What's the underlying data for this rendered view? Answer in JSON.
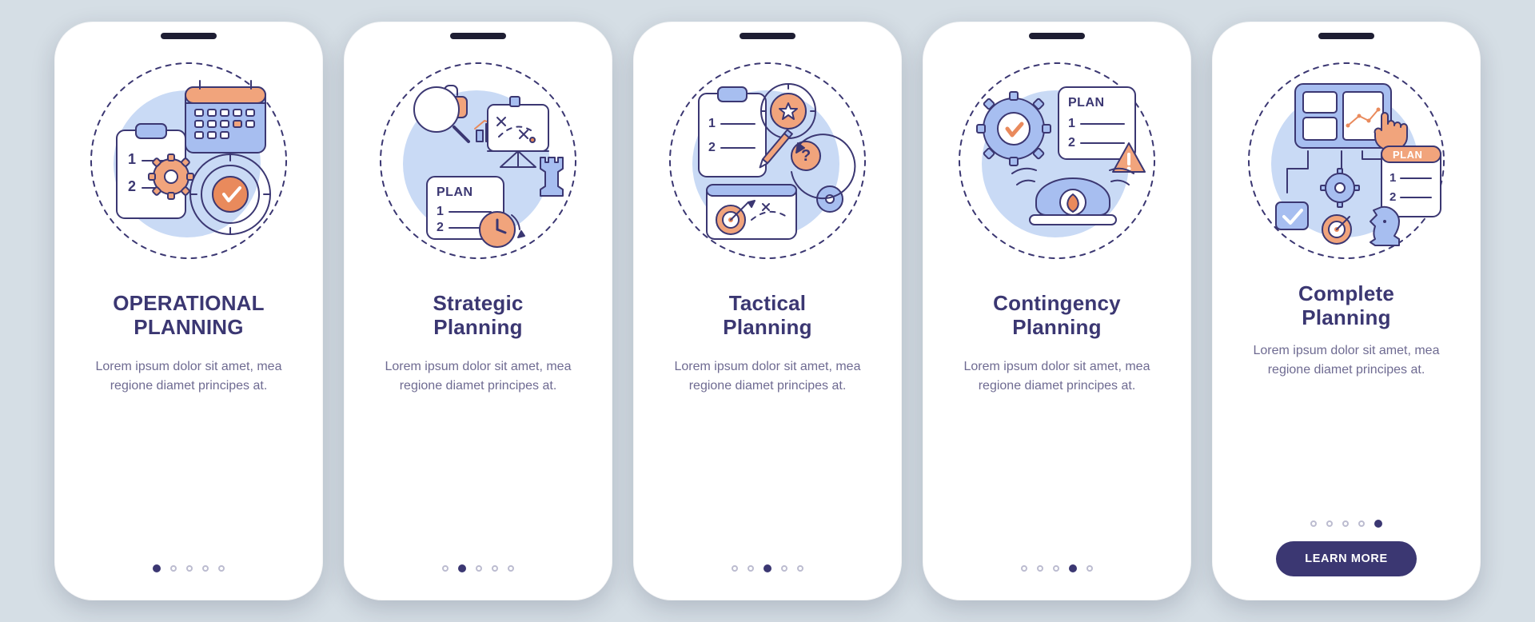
{
  "meta": {
    "dimensions": "1920x778"
  },
  "colors": {
    "background": "#d5dee5",
    "surface": "#ffffff",
    "primary": "#3b3772",
    "accent_blue": "#a7bef0",
    "accent_orange": "#f1a47c",
    "dot_inactive": "#bcbcd0"
  },
  "lorem": "Lorem ipsum dolor sit amet, mea regione diamet principes at.",
  "cta_label": "LEARN MORE",
  "svg_labels": {
    "plan": "PLAN",
    "one": "1",
    "two": "2"
  },
  "screens": [
    {
      "id": "operational",
      "title_line1": "OPERATIONAL",
      "title_line2": "PLANNING",
      "title_case": "upper",
      "icon": "operational-illustration",
      "icon_elements": [
        "calendar-icon",
        "clipboard-icon",
        "gear-icon",
        "target-check-icon",
        "dashed-circle-icon"
      ],
      "active_dot_index": 0,
      "has_cta": false
    },
    {
      "id": "strategic",
      "title_line1": "Strategic",
      "title_line2": "Planning",
      "title_case": "title",
      "icon": "strategic-illustration",
      "icon_elements": [
        "magnifier-icon",
        "briefcase-icon",
        "bar-chart-icon",
        "whiteboard-plan-icon",
        "rook-icon",
        "plan-sheet-icon",
        "clock-icon",
        "dashed-circle-icon"
      ],
      "active_dot_index": 1,
      "has_cta": false
    },
    {
      "id": "tactical",
      "title_line1": "Tactical",
      "title_line2": "Planning",
      "title_case": "title",
      "icon": "tactical-illustration",
      "icon_elements": [
        "clipboard-icon",
        "star-target-icon",
        "pencil-icon",
        "dartboard-icon",
        "question-orbit-icon",
        "gear-icon",
        "arrow-cycle-icon",
        "dashed-circle-icon"
      ],
      "active_dot_index": 2,
      "has_cta": false
    },
    {
      "id": "contingency",
      "title_line1": "Contingency",
      "title_line2": "Planning",
      "title_case": "title",
      "icon": "contingency-illustration",
      "icon_elements": [
        "gear-check-icon",
        "plan-sheet-icon",
        "warning-icon",
        "fire-alarm-icon",
        "dashed-circle-icon"
      ],
      "active_dot_index": 3,
      "has_cta": false
    },
    {
      "id": "complete",
      "title_line1": "Complete",
      "title_line2": "Planning",
      "title_case": "title",
      "icon": "complete-illustration",
      "icon_elements": [
        "dashboard-tap-icon",
        "plan-sheet-icon",
        "gear-icon",
        "check-box-icon",
        "dartboard-icon",
        "knight-icon",
        "flow-lines-icon",
        "dashed-circle-icon"
      ],
      "active_dot_index": 4,
      "has_cta": true
    }
  ]
}
